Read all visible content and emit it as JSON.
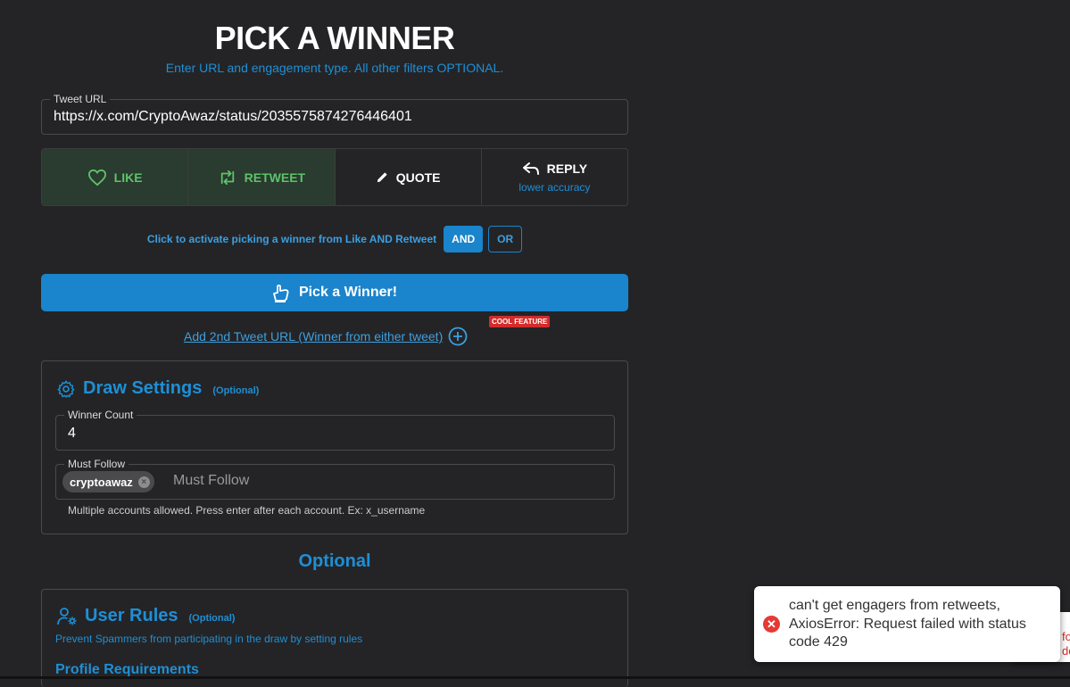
{
  "header": {
    "title": "PICK A WINNER",
    "subtitle": "Enter URL and engagement type. All other filters OPTIONAL."
  },
  "tweet_url": {
    "label": "Tweet URL",
    "value": "https://x.com/CryptoAwaz/status/2035575874276446401"
  },
  "engagement": {
    "like": "LIKE",
    "retweet": "RETWEET",
    "quote": "QUOTE",
    "reply": "REPLY",
    "reply_sub": "lower accuracy",
    "active": [
      "like",
      "retweet"
    ],
    "active_color": "#5ec26a"
  },
  "logic": {
    "text": "Click to activate picking a winner from Like AND Retweet",
    "and": "AND",
    "or": "OR",
    "selected": "AND"
  },
  "pick_button": {
    "label": "Pick a Winner!"
  },
  "second_tweet": {
    "link": "Add 2nd Tweet URL (Winner from either tweet)",
    "badge": "COOL FEATURE"
  },
  "draw_settings": {
    "title": "Draw Settings",
    "optional": "(Optional)",
    "winner_count": {
      "label": "Winner Count",
      "value": "4"
    },
    "must_follow": {
      "label": "Must Follow",
      "chips": [
        "cryptoawaz"
      ],
      "placeholder": "Must Follow",
      "help": "Multiple accounts allowed. Press enter after each account. Ex: x_username"
    }
  },
  "optional_heading": "Optional",
  "user_rules": {
    "title": "User Rules",
    "optional": "(Optional)",
    "description": "Prevent Spammers from participating in the draw by setting rules",
    "profile_requirements": "Profile Requirements"
  },
  "toast": {
    "message": "can't get engagers from retweets, AxiosError: Request failed with status code 429",
    "behind_text": "fo do",
    "icon": "error-icon"
  },
  "colors": {
    "accent": "#1e8fd6",
    "button": "#1a84cc",
    "background": "#242426",
    "error": "#e53935"
  }
}
